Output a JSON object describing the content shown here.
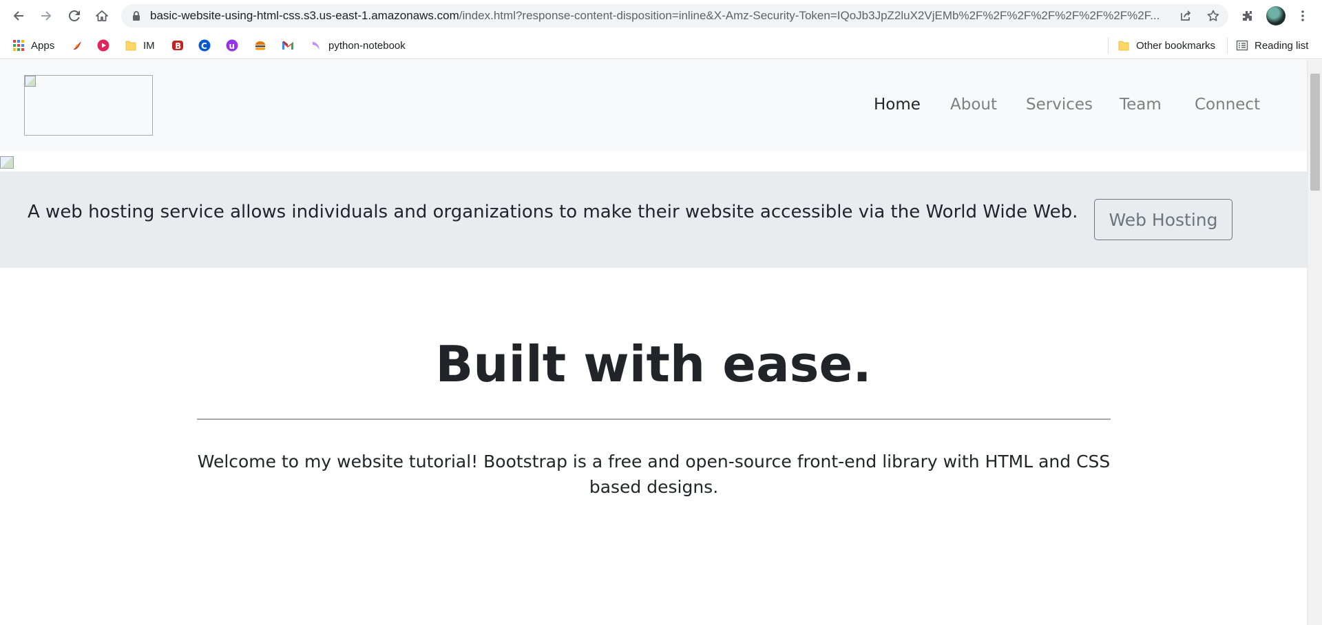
{
  "browser": {
    "url_host": "basic-website-using-html-css.s3.us-east-1.amazonaws.com",
    "url_rest": "/index.html?response-content-disposition=inline&X-Amz-Security-Token=IQoJb3JpZ2luX2VjEMb%2F%2F%2F%2F%2F%2F%2F%2F...",
    "bookmarks": {
      "apps": "Apps",
      "im": "IM",
      "python_notebook": "python-notebook",
      "other_bookmarks": "Other bookmarks",
      "reading_list": "Reading list"
    }
  },
  "site": {
    "nav": {
      "home": "Home",
      "about": "About",
      "services": "Services",
      "team": "Team",
      "connect": "Connect"
    },
    "jumbotron": {
      "text": "A web hosting service allows individuals and organizations to make their website accessible via the World Wide Web.",
      "button": "Web Hosting"
    },
    "headline": "Built with ease.",
    "welcome": "Welcome to my website tutorial! Bootstrap is a free and open-source front-end library with HTML and CSS based designs."
  },
  "colors": {
    "navbar_bg": "#f8f9fa",
    "jumbotron_bg": "#e9ecef",
    "text_dark": "#212529",
    "nav_muted": "#7f7f7f",
    "button_border": "#6c757d"
  }
}
